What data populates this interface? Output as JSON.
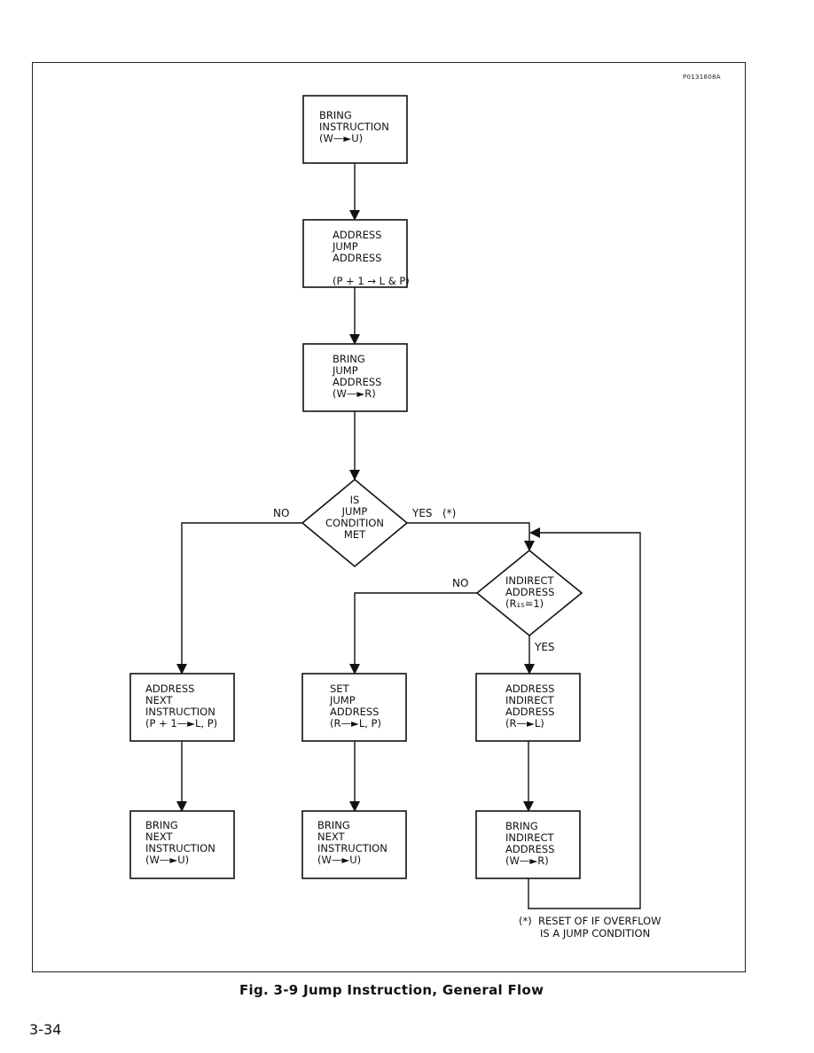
{
  "reference_code": "P0131808A",
  "caption": "Fig. 3-9   Jump Instruction, General Flow",
  "page_number": "3-34",
  "footnote": {
    "marker": "(*)",
    "line1": "RESET OF IF OVERFLOW",
    "line2": "IS A JUMP CONDITION"
  },
  "nodes": [
    {
      "id": "bring-instruction",
      "shape": "box",
      "lines": [
        "BRING",
        "INSTRUCTION",
        "(W—►U)"
      ]
    },
    {
      "id": "address-jump-address",
      "shape": "box",
      "lines": [
        "ADDRESS",
        "JUMP",
        "ADDRESS",
        "",
        "(P + 1 → L & P)"
      ]
    },
    {
      "id": "bring-jump-address",
      "shape": "box",
      "lines": [
        "BRING",
        "JUMP",
        "ADDRESS",
        "(W—►R)"
      ]
    },
    {
      "id": "is-jump-condition-met",
      "shape": "diamond",
      "lines": [
        "IS",
        "JUMP",
        "CONDITION",
        "MET"
      ]
    },
    {
      "id": "indirect-address",
      "shape": "diamond",
      "lines": [
        "INDIRECT",
        "ADDRESS",
        "(R₁₅=1)"
      ]
    },
    {
      "id": "address-next-instruction",
      "shape": "box",
      "lines": [
        "ADDRESS",
        "NEXT",
        "INSTRUCTION",
        "(P + 1—►L, P)"
      ]
    },
    {
      "id": "set-jump-address",
      "shape": "box",
      "lines": [
        "SET",
        "JUMP",
        "ADDRESS",
        "(R—►L, P)"
      ]
    },
    {
      "id": "address-indirect-address",
      "shape": "box",
      "lines": [
        "ADDRESS",
        "INDIRECT",
        "ADDRESS",
        "(R—►L)"
      ]
    },
    {
      "id": "bring-next-instruction-1",
      "shape": "box",
      "lines": [
        "BRING",
        "NEXT",
        "INSTRUCTION",
        "(W—►U)"
      ]
    },
    {
      "id": "bring-next-instruction-2",
      "shape": "box",
      "lines": [
        "BRING",
        "NEXT",
        "INSTRUCTION",
        "(W—►U)"
      ]
    },
    {
      "id": "bring-indirect-address",
      "shape": "box",
      "lines": [
        "BRING",
        "INDIRECT",
        "ADDRESS",
        "(W—►R)"
      ]
    }
  ],
  "edges": [
    {
      "from": "bring-instruction",
      "to": "address-jump-address",
      "label": ""
    },
    {
      "from": "address-jump-address",
      "to": "bring-jump-address",
      "label": ""
    },
    {
      "from": "bring-jump-address",
      "to": "is-jump-condition-met",
      "label": ""
    },
    {
      "from": "is-jump-condition-met",
      "to": "address-next-instruction",
      "label": "NO"
    },
    {
      "from": "is-jump-condition-met",
      "to": "indirect-address",
      "label": "YES   (*)"
    },
    {
      "from": "indirect-address",
      "to": "set-jump-address",
      "label": "NO"
    },
    {
      "from": "indirect-address",
      "to": "address-indirect-address",
      "label": "YES"
    },
    {
      "from": "address-next-instruction",
      "to": "bring-next-instruction-1",
      "label": ""
    },
    {
      "from": "set-jump-address",
      "to": "bring-next-instruction-2",
      "label": ""
    },
    {
      "from": "address-indirect-address",
      "to": "bring-indirect-address",
      "label": ""
    },
    {
      "from": "bring-indirect-address",
      "to": "indirect-address",
      "label": ""
    }
  ]
}
